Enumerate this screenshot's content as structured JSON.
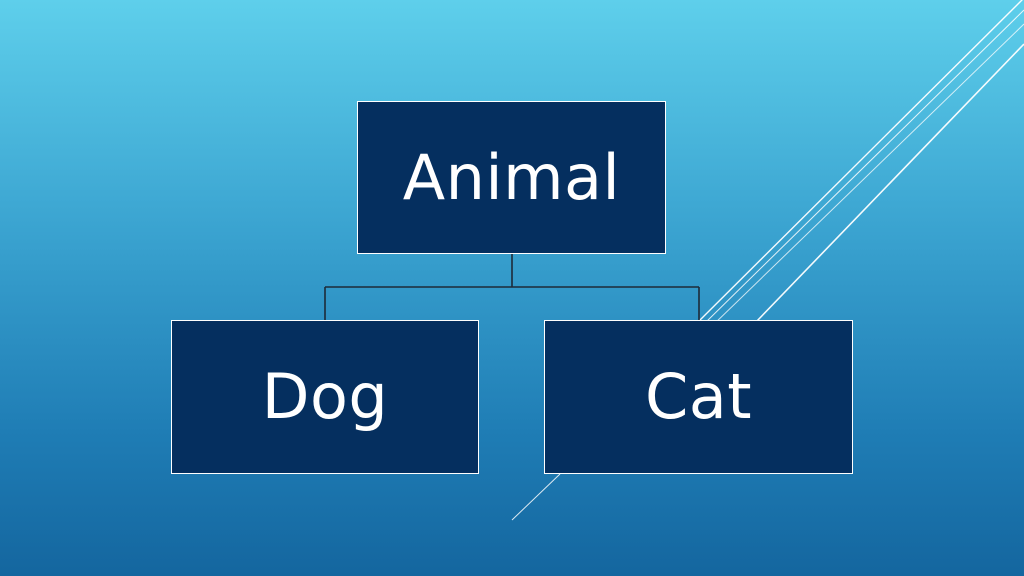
{
  "diagram": {
    "root": {
      "label": "Animal"
    },
    "children": [
      {
        "label": "Dog"
      },
      {
        "label": "Cat"
      }
    ]
  },
  "colors": {
    "background_top": "#5ecfeb",
    "background_bottom": "#14669f",
    "node_fill": "#052f5f",
    "node_border": "#ffffff",
    "text": "#ffffff",
    "connector": "#1d2a38"
  }
}
